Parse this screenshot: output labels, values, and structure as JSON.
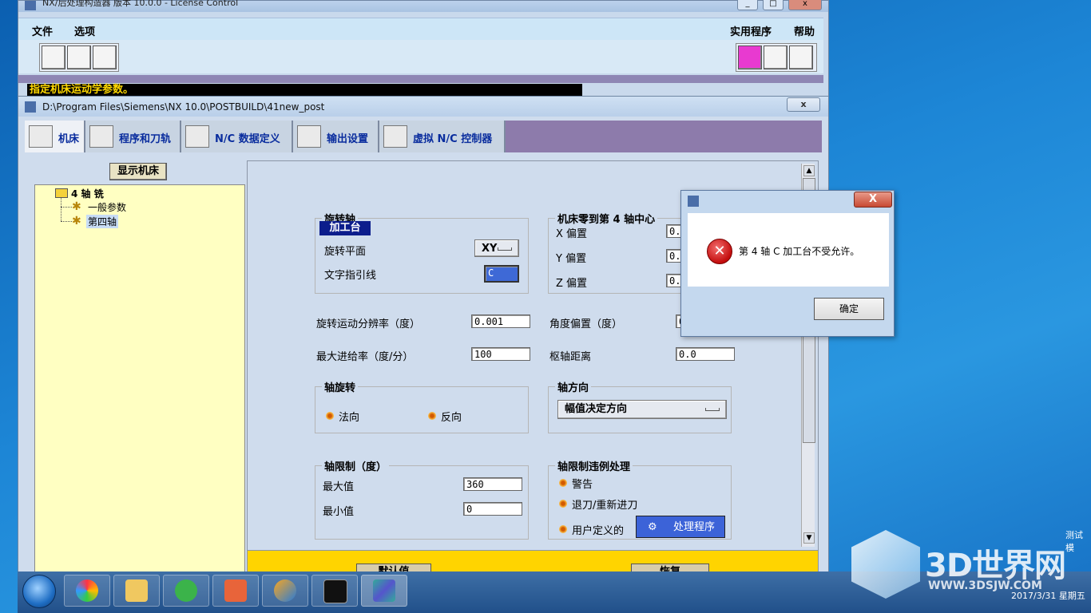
{
  "main_window": {
    "title": "NX/后处理构造器 版本 10.0.0 - License Control",
    "menu": {
      "file": "文件",
      "options": "选项",
      "utilities": "实用程序",
      "help": "帮助"
    },
    "status_text": "指定机床运动学参数。"
  },
  "project_window": {
    "title": "D:\\Program Files\\Siemens\\NX 10.0\\POSTBUILD\\41new_post",
    "tabs": [
      {
        "label": "机床"
      },
      {
        "label": "程序和刀轨"
      },
      {
        "label": "N/C 数据定义"
      },
      {
        "label": "输出设置"
      },
      {
        "label": "虚拟 N/C 控制器"
      }
    ],
    "show_machine_button": "显示机床",
    "tree": {
      "root": "4 轴 铣",
      "children": [
        "一般参数",
        "第四轴"
      ]
    }
  },
  "rotary_axis": {
    "legend": "旋转轴",
    "type_label": "加工台",
    "plane_label": "旋转平面",
    "plane_value": "XY",
    "leader_label": "文字指引线",
    "leader_value": "C"
  },
  "zero_offset": {
    "legend": "机床零到第 4 轴中心",
    "x_label": "X 偏置",
    "y_label": "Y 偏置",
    "z_label": "Z 偏置",
    "x_value": "0.",
    "y_value": "0.",
    "z_value": "0."
  },
  "params": {
    "resolution_label": "旋转运动分辨率（度）",
    "resolution_value": "0.001",
    "angle_offset_label": "角度偏置（度）",
    "angle_offset_value": "0",
    "max_feed_label": "最大进给率（度/分）",
    "max_feed_value": "100",
    "pivot_label": "枢轴距离",
    "pivot_value": "0.0"
  },
  "axis_rotation": {
    "legend": "轴旋转",
    "normal": "法向",
    "reverse": "反向"
  },
  "axis_direction": {
    "legend": "轴方向",
    "value": "幅值决定方向"
  },
  "axis_limits": {
    "legend": "轴限制（度）",
    "max_label": "最大值",
    "max_value": "360",
    "min_label": "最小值",
    "min_value": "0"
  },
  "limit_violation": {
    "legend": "轴限制违例处理",
    "warning": "警告",
    "retract": "退刀/重新进刀",
    "user_defined": "用户定义的",
    "handler_button": "处理程序"
  },
  "bottom_buttons": {
    "default": "默认值",
    "restore": "恢复"
  },
  "dialog": {
    "message": "第 4 轴 C 加工台不受允许。",
    "ok": "确定",
    "close": "X"
  },
  "watermark": {
    "brand": "3D世界网",
    "url": "WWW.3DSJW.COM"
  },
  "tray": {
    "clock": "2017/3/31 星期五",
    "text": "测试模"
  },
  "colors": {
    "accent_purple": "#8d7bab",
    "status_yellow": "#ffd800",
    "bottom_yellow": "#ffd400"
  }
}
